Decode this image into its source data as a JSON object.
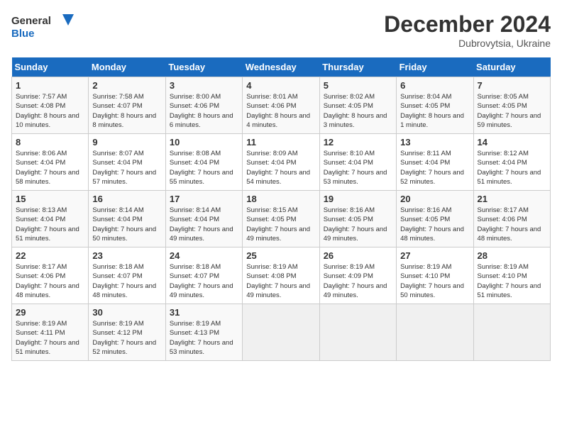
{
  "header": {
    "logo_line1": "General",
    "logo_line2": "Blue",
    "month": "December 2024",
    "location": "Dubrovytsia, Ukraine"
  },
  "days_of_week": [
    "Sunday",
    "Monday",
    "Tuesday",
    "Wednesday",
    "Thursday",
    "Friday",
    "Saturday"
  ],
  "weeks": [
    [
      {
        "day": "1",
        "sunrise": "7:57 AM",
        "sunset": "4:08 PM",
        "daylight": "8 hours and 10 minutes."
      },
      {
        "day": "2",
        "sunrise": "7:58 AM",
        "sunset": "4:07 PM",
        "daylight": "8 hours and 8 minutes."
      },
      {
        "day": "3",
        "sunrise": "8:00 AM",
        "sunset": "4:06 PM",
        "daylight": "8 hours and 6 minutes."
      },
      {
        "day": "4",
        "sunrise": "8:01 AM",
        "sunset": "4:06 PM",
        "daylight": "8 hours and 4 minutes."
      },
      {
        "day": "5",
        "sunrise": "8:02 AM",
        "sunset": "4:05 PM",
        "daylight": "8 hours and 3 minutes."
      },
      {
        "day": "6",
        "sunrise": "8:04 AM",
        "sunset": "4:05 PM",
        "daylight": "8 hours and 1 minute."
      },
      {
        "day": "7",
        "sunrise": "8:05 AM",
        "sunset": "4:05 PM",
        "daylight": "7 hours and 59 minutes."
      }
    ],
    [
      {
        "day": "8",
        "sunrise": "8:06 AM",
        "sunset": "4:04 PM",
        "daylight": "7 hours and 58 minutes."
      },
      {
        "day": "9",
        "sunrise": "8:07 AM",
        "sunset": "4:04 PM",
        "daylight": "7 hours and 57 minutes."
      },
      {
        "day": "10",
        "sunrise": "8:08 AM",
        "sunset": "4:04 PM",
        "daylight": "7 hours and 55 minutes."
      },
      {
        "day": "11",
        "sunrise": "8:09 AM",
        "sunset": "4:04 PM",
        "daylight": "7 hours and 54 minutes."
      },
      {
        "day": "12",
        "sunrise": "8:10 AM",
        "sunset": "4:04 PM",
        "daylight": "7 hours and 53 minutes."
      },
      {
        "day": "13",
        "sunrise": "8:11 AM",
        "sunset": "4:04 PM",
        "daylight": "7 hours and 52 minutes."
      },
      {
        "day": "14",
        "sunrise": "8:12 AM",
        "sunset": "4:04 PM",
        "daylight": "7 hours and 51 minutes."
      }
    ],
    [
      {
        "day": "15",
        "sunrise": "8:13 AM",
        "sunset": "4:04 PM",
        "daylight": "7 hours and 51 minutes."
      },
      {
        "day": "16",
        "sunrise": "8:14 AM",
        "sunset": "4:04 PM",
        "daylight": "7 hours and 50 minutes."
      },
      {
        "day": "17",
        "sunrise": "8:14 AM",
        "sunset": "4:04 PM",
        "daylight": "7 hours and 49 minutes."
      },
      {
        "day": "18",
        "sunrise": "8:15 AM",
        "sunset": "4:05 PM",
        "daylight": "7 hours and 49 minutes."
      },
      {
        "day": "19",
        "sunrise": "8:16 AM",
        "sunset": "4:05 PM",
        "daylight": "7 hours and 49 minutes."
      },
      {
        "day": "20",
        "sunrise": "8:16 AM",
        "sunset": "4:05 PM",
        "daylight": "7 hours and 48 minutes."
      },
      {
        "day": "21",
        "sunrise": "8:17 AM",
        "sunset": "4:06 PM",
        "daylight": "7 hours and 48 minutes."
      }
    ],
    [
      {
        "day": "22",
        "sunrise": "8:17 AM",
        "sunset": "4:06 PM",
        "daylight": "7 hours and 48 minutes."
      },
      {
        "day": "23",
        "sunrise": "8:18 AM",
        "sunset": "4:07 PM",
        "daylight": "7 hours and 48 minutes."
      },
      {
        "day": "24",
        "sunrise": "8:18 AM",
        "sunset": "4:07 PM",
        "daylight": "7 hours and 49 minutes."
      },
      {
        "day": "25",
        "sunrise": "8:19 AM",
        "sunset": "4:08 PM",
        "daylight": "7 hours and 49 minutes."
      },
      {
        "day": "26",
        "sunrise": "8:19 AM",
        "sunset": "4:09 PM",
        "daylight": "7 hours and 49 minutes."
      },
      {
        "day": "27",
        "sunrise": "8:19 AM",
        "sunset": "4:10 PM",
        "daylight": "7 hours and 50 minutes."
      },
      {
        "day": "28",
        "sunrise": "8:19 AM",
        "sunset": "4:10 PM",
        "daylight": "7 hours and 51 minutes."
      }
    ],
    [
      {
        "day": "29",
        "sunrise": "8:19 AM",
        "sunset": "4:11 PM",
        "daylight": "7 hours and 51 minutes."
      },
      {
        "day": "30",
        "sunrise": "8:19 AM",
        "sunset": "4:12 PM",
        "daylight": "7 hours and 52 minutes."
      },
      {
        "day": "31",
        "sunrise": "8:19 AM",
        "sunset": "4:13 PM",
        "daylight": "7 hours and 53 minutes."
      },
      null,
      null,
      null,
      null
    ]
  ],
  "labels": {
    "sunrise": "Sunrise:",
    "sunset": "Sunset:",
    "daylight": "Daylight:"
  }
}
